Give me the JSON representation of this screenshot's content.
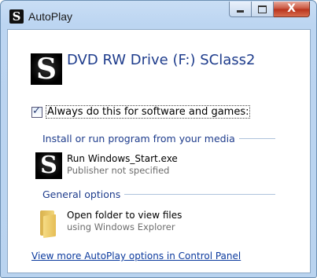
{
  "window": {
    "title": "AutoPlay",
    "app_icon_letter": "S",
    "controls": {
      "minimize": "minimize",
      "maximize": "maximize",
      "close_glyph": "X"
    }
  },
  "device": {
    "logo_letter": "S",
    "title": "DVD RW Drive (F:) SClass2"
  },
  "always_checkbox": {
    "checked": true,
    "check_glyph": "✓",
    "label": "Always do this for software and games:"
  },
  "sections": {
    "install": {
      "header": "Install or run program from your media",
      "option": {
        "logo_letter": "S",
        "title": "Run Windows_Start.exe",
        "subtitle": "Publisher not specified"
      }
    },
    "general": {
      "header": "General options",
      "option": {
        "icon": "folder-icon",
        "title": "Open folder to view files",
        "subtitle": "using Windows Explorer"
      }
    }
  },
  "footer_link": "View more AutoPlay options in Control Panel",
  "colors": {
    "link": "#0b3a9e",
    "heading": "#1e3c8c",
    "close_button": "#c7503a"
  }
}
